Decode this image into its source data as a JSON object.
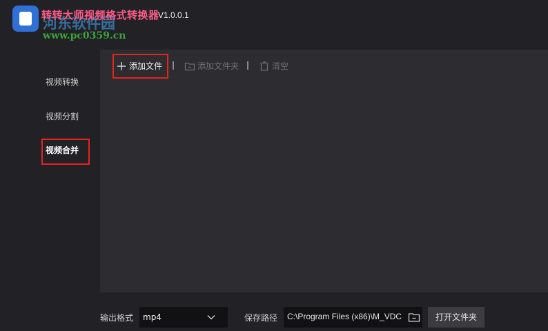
{
  "app": {
    "title": "转转大师视频格式转换器",
    "version": "V1.0.0.1",
    "watermark_text": "河东软件园",
    "watermark_url": "www.pc0359.cn"
  },
  "sidebar": {
    "items": [
      {
        "label": "视频转换"
      },
      {
        "label": "视频分割"
      },
      {
        "label": "视频合并"
      }
    ],
    "active_index": 2
  },
  "toolbar": {
    "add_file": "添加文件",
    "add_folder": "添加文件夹",
    "clear": "清空"
  },
  "bottom": {
    "format_label": "输出格式",
    "format_value": "mp4",
    "save_path_label": "保存路径",
    "save_path_value": "C:\\Program Files (x86)\\M_VDC",
    "open_folder": "打开文件夹"
  },
  "colors": {
    "highlight": "#e6231f",
    "panel": "#2d2d31",
    "background": "#222226",
    "accent_title": "#ff5a86"
  }
}
